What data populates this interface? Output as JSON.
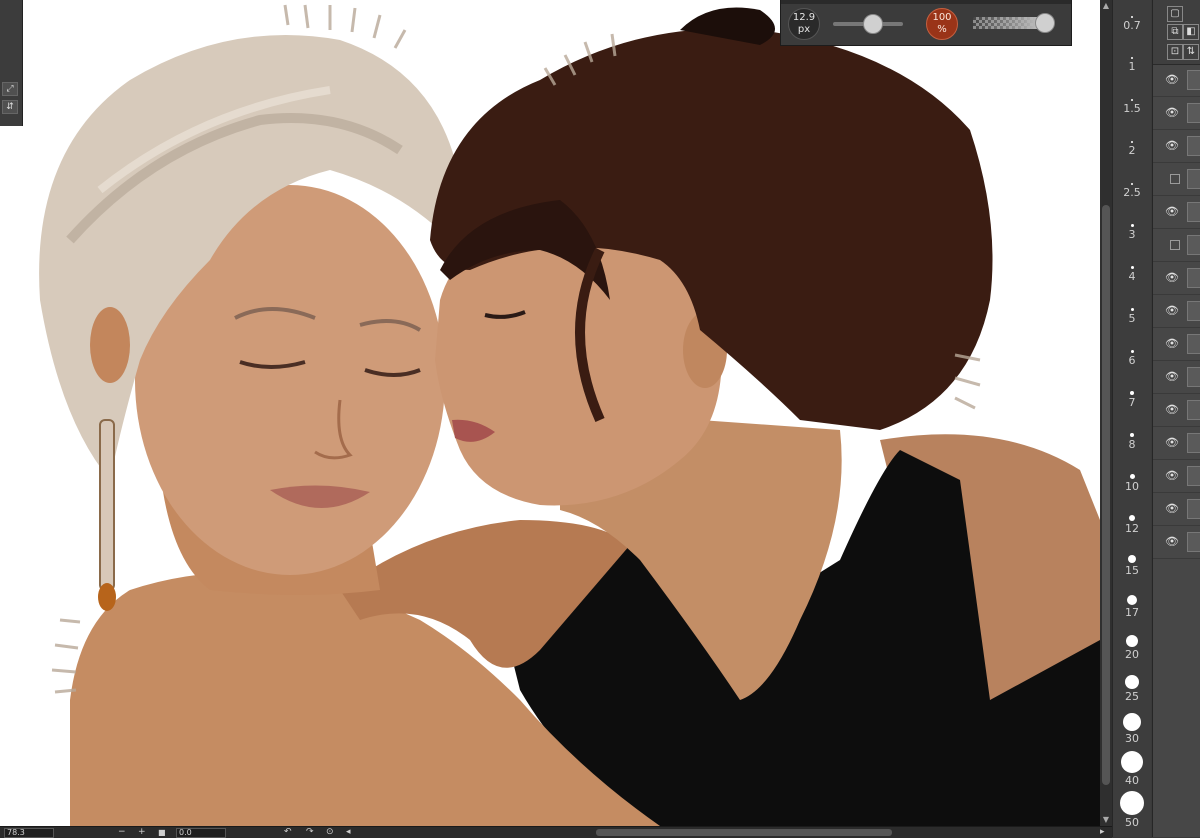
{
  "brush_popup": {
    "size_value": "12.9",
    "size_unit": "px",
    "opacity_value": "100",
    "opacity_unit": "%",
    "size_slider_level": 0.55,
    "opacity_slider_level": 1.0
  },
  "brush_sizes": [
    {
      "label": "0.7"
    },
    {
      "label": "1"
    },
    {
      "label": "1.5"
    },
    {
      "label": "2"
    },
    {
      "label": "2.5"
    },
    {
      "label": "3"
    },
    {
      "label": "4"
    },
    {
      "label": "5"
    },
    {
      "label": "6"
    },
    {
      "label": "7"
    },
    {
      "label": "8"
    },
    {
      "label": "10"
    },
    {
      "label": "12"
    },
    {
      "label": "15"
    },
    {
      "label": "17"
    },
    {
      "label": "20"
    },
    {
      "label": "25"
    },
    {
      "label": "30"
    },
    {
      "label": "40"
    },
    {
      "label": "50"
    }
  ],
  "layers": [
    {
      "visible": true
    },
    {
      "visible": true
    },
    {
      "visible": true
    },
    {
      "visible": false
    },
    {
      "visible": true
    },
    {
      "visible": false
    },
    {
      "visible": true
    },
    {
      "visible": true
    },
    {
      "visible": true
    },
    {
      "visible": true
    },
    {
      "visible": true
    },
    {
      "visible": true
    },
    {
      "visible": true
    },
    {
      "visible": true
    },
    {
      "visible": true
    }
  ],
  "status_bar": {
    "zoom": "78.3",
    "zoom_out": "−",
    "zoom_in": "+",
    "rotation": "0.0"
  },
  "colors": {
    "accent_opacity": "#9a3418",
    "panel_bg": "#3d3d3d",
    "canvas_bg": "#ffffff"
  }
}
